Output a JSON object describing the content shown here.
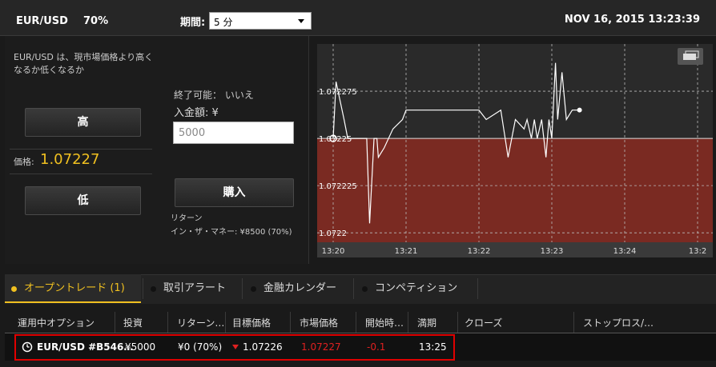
{
  "header": {
    "symbol": "EUR/USD",
    "payout": "70%",
    "period_label": "期間:",
    "period_value": "5 分",
    "datetime": "NOV 16, 2015 13:23:39"
  },
  "trade_panel": {
    "question": "EUR/USD は、現市場価格より高くなるか低くなるか",
    "high_label": "高",
    "low_label": "低",
    "price_label": "価格:",
    "price_value": "1.07227"
  },
  "order_panel": {
    "end_possible": "終了可能： いいえ",
    "deposit_label": "入金額: ¥",
    "amount_value": "5000",
    "buy_label": "購入",
    "return_label": "リターン",
    "itm_label": "イン・ザ・マネー: ¥8500 (70%)"
  },
  "chart_data": {
    "type": "line",
    "x_ticks": [
      "13:20",
      "13:21",
      "13:22",
      "13:23",
      "13:24",
      "13:2"
    ],
    "y_ticks": [
      "1.072275",
      "1.07225",
      "1.072225",
      "1.0722"
    ],
    "ylim": [
      1.072195,
      1.0723
    ],
    "strike": 1.07225,
    "series": [
      {
        "x": [
          0,
          0.04,
          0.15,
          0.2,
          0.32,
          0.38,
          0.46,
          0.5,
          0.56,
          0.6,
          0.62,
          0.7,
          0.82,
          0.95,
          1.0,
          1.04,
          1.08,
          1.1,
          1.12,
          1.16,
          1.2,
          1.24,
          1.28,
          1.35,
          1.5,
          1.55,
          1.62,
          1.7,
          1.78,
          1.84,
          1.92,
          2.0,
          2.1,
          2.3,
          2.4,
          2.5,
          2.62,
          2.66,
          2.72,
          2.76,
          2.8,
          2.86,
          2.92,
          2.96,
          3.0,
          3.05,
          3.08,
          3.14,
          3.2,
          3.28,
          3.38
        ],
        "y": [
          1.07225,
          1.07228,
          1.07226,
          1.07225,
          1.07225,
          1.07225,
          1.07225,
          1.072205,
          1.07225,
          1.07225,
          1.07224,
          1.072245,
          1.072255,
          1.07226,
          1.072265,
          1.072265,
          1.072265,
          1.072265,
          1.072265,
          1.072265,
          1.072265,
          1.072265,
          1.072265,
          1.072265,
          1.072265,
          1.072265,
          1.072265,
          1.072265,
          1.072265,
          1.072265,
          1.072265,
          1.072265,
          1.07226,
          1.072265,
          1.07224,
          1.07226,
          1.072255,
          1.07226,
          1.07225,
          1.07226,
          1.07225,
          1.07226,
          1.07224,
          1.07226,
          1.07225,
          1.07229,
          1.07226,
          1.072285,
          1.07226,
          1.072265,
          1.072265
        ]
      }
    ]
  },
  "tabs": [
    {
      "label": "オープントレード (1)"
    },
    {
      "label": "取引アラート"
    },
    {
      "label": "金融カレンダー"
    },
    {
      "label": "コンペティション"
    }
  ],
  "table": {
    "headers": [
      "運用中オプション",
      "投資",
      "リターン…",
      "目標価格",
      "市場価格",
      "開始時…",
      "満期",
      "クローズ",
      "ストップロス/…"
    ],
    "row": {
      "option": "EUR/USD #B546…",
      "investment": "¥5000",
      "return": "¥0 (70%)",
      "target": "1.07226",
      "market": "1.07227",
      "start": "-0.1",
      "expiry": "13:25"
    }
  },
  "colors": {
    "accent": "#f0c020",
    "chart_red": "#7a2a22",
    "negative": "#e02020"
  }
}
